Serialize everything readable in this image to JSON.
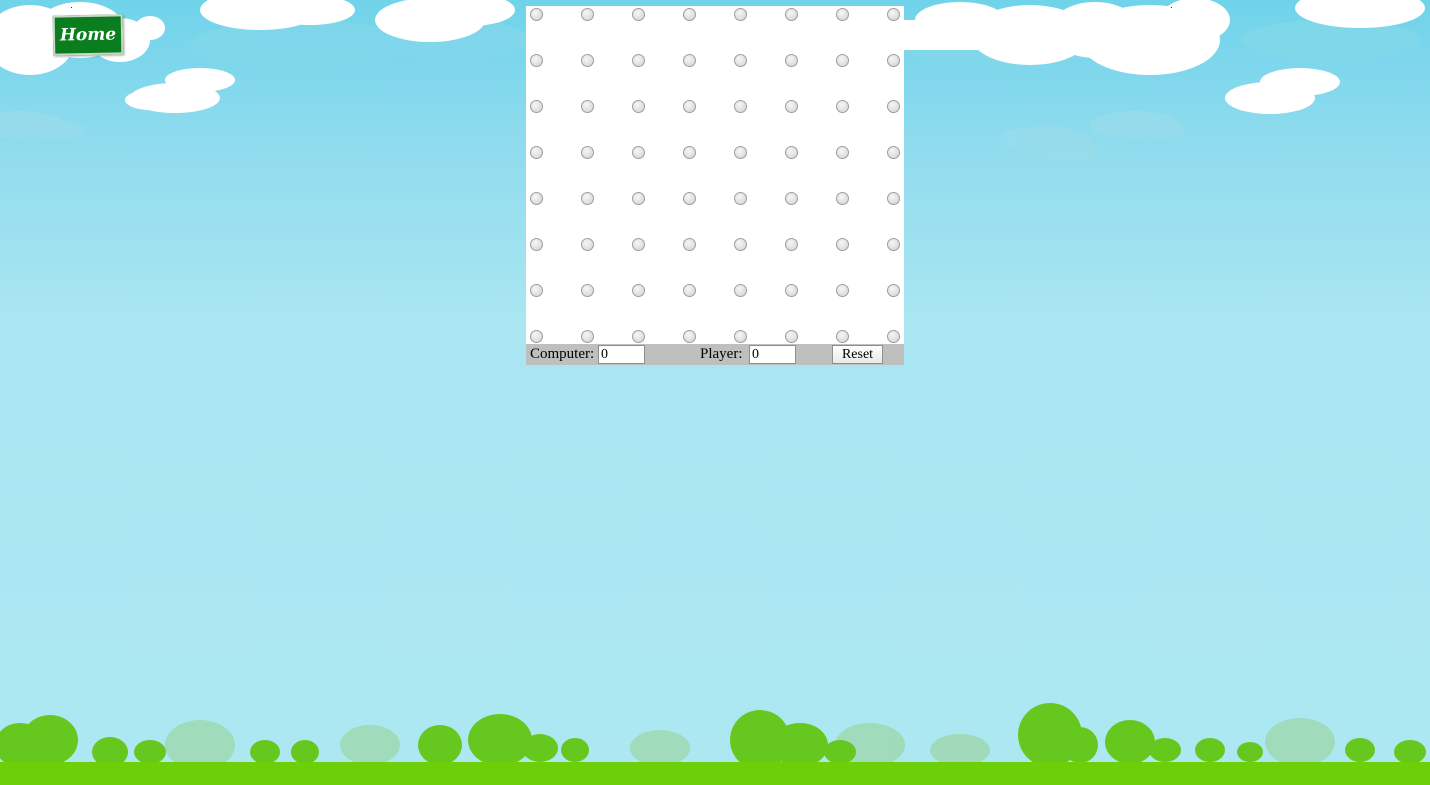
{
  "home_button": {
    "label": "Home",
    "color": "#0a7d1e"
  },
  "board": {
    "rows": 8,
    "cols": 8,
    "background": "#ffffff"
  },
  "score_bar": {
    "computer_label": "Computer:",
    "computer_value": "0",
    "player_label": "Player:",
    "player_value": "0",
    "reset_label": "Reset",
    "background": "#c0bfc0"
  },
  "colors": {
    "sky_top": "#6fd3ea",
    "sky_bottom": "#ade8f2",
    "grass": "#6ccf08",
    "tree": "#63c81e"
  }
}
